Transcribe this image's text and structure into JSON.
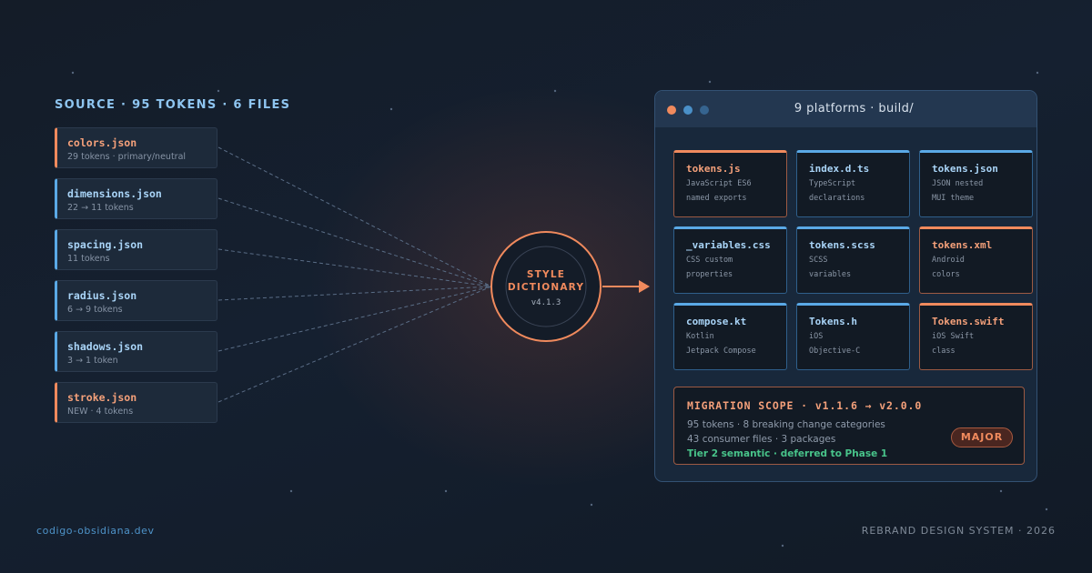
{
  "source": {
    "title": "SOURCE · 95 TOKENS · 6 FILES",
    "files": [
      {
        "name": "colors.json",
        "detail": "29 tokens · primary/neutral",
        "accent": "orange"
      },
      {
        "name": "dimensions.json",
        "detail": "22 → 11 tokens",
        "accent": "blue"
      },
      {
        "name": "spacing.json",
        "detail": "11 tokens",
        "accent": "blue"
      },
      {
        "name": "radius.json",
        "detail": "6 → 9 tokens",
        "accent": "blue"
      },
      {
        "name": "shadows.json",
        "detail": "3 → 1 token",
        "accent": "blue"
      },
      {
        "name": "stroke.json",
        "detail": "NEW · 4 tokens",
        "accent": "orange"
      }
    ]
  },
  "hub": {
    "line1": "STYLE",
    "line2": "DICTIONARY",
    "version": "v4.1.3"
  },
  "output": {
    "title": "9 platforms · build/",
    "files": [
      {
        "name": "tokens.js",
        "line1": "JavaScript ES6",
        "line2": "named exports",
        "accent": "orange"
      },
      {
        "name": "index.d.ts",
        "line1": "TypeScript",
        "line2": "declarations",
        "accent": "blue"
      },
      {
        "name": "tokens.json",
        "line1": "JSON nested",
        "line2": "MUI theme",
        "accent": "blue"
      },
      {
        "name": "_variables.css",
        "line1": "CSS custom",
        "line2": "properties",
        "accent": "blue"
      },
      {
        "name": "tokens.scss",
        "line1": "SCSS",
        "line2": "variables",
        "accent": "blue"
      },
      {
        "name": "tokens.xml",
        "line1": "Android",
        "line2": "colors",
        "accent": "orange"
      },
      {
        "name": "compose.kt",
        "line1": "Kotlin",
        "line2": "Jetpack Compose",
        "accent": "blue"
      },
      {
        "name": "Tokens.h",
        "line1": "iOS",
        "line2": "Objective-C",
        "accent": "blue"
      },
      {
        "name": "Tokens.swift",
        "line1": "iOS Swift",
        "line2": "class",
        "accent": "orange"
      }
    ]
  },
  "migration": {
    "title": "MIGRATION SCOPE · v1.1.6 → v2.0.0",
    "line1": "95 tokens · 8 breaking change categories",
    "line2": "43 consumer files · 3 packages",
    "line3": "Tier 2 semantic · deferred to Phase 1",
    "badge": "MAJOR"
  },
  "footer": {
    "left": "codigo-obsidiana.dev",
    "right": "REBRAND DESIGN SYSTEM · 2026"
  },
  "colors": {
    "orange": "#f08a5d",
    "blue": "#5aa9e6",
    "green": "#48c48a"
  }
}
